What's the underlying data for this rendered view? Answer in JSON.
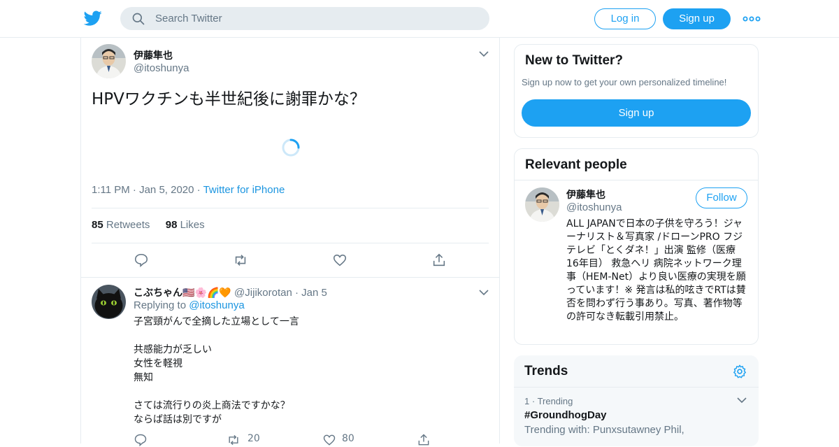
{
  "colors": {
    "accent": "#1da1f2",
    "link": "#1b95e0",
    "muted": "#657786",
    "border": "#e6ecf0",
    "like": "#e0245e"
  },
  "header": {
    "logo_icon": "twitter-bird-icon",
    "search_placeholder": "Search Twitter",
    "login_label": "Log in",
    "signup_label": "Sign up",
    "more_icon": "more-dots-icon"
  },
  "tweet": {
    "name": "伊藤隼也",
    "handle": "@itoshunya",
    "text": "HPVワクチンも半世紀後に謝罪かな？",
    "time": "1:11 PM",
    "date": "Jan 5, 2020",
    "source": "Twitter for iPhone",
    "retweets_count": "85",
    "retweets_label": "Retweets",
    "likes_count": "98",
    "likes_label": "Likes"
  },
  "reply": {
    "name": "こぶちゃん🇺🇸🌸🌈🧡",
    "handle": "@Jijikorotan",
    "date": "Jan 5",
    "replying_prefix": "Replying to",
    "replying_to": "@itoshunya",
    "lines": [
      "子宮頸がんで全摘した立場として一言",
      "",
      "共感能力が乏しい",
      "女性を軽視",
      "無知",
      "",
      "さては流行りの炎上商法ですかな？",
      "ならば話は別ですが"
    ],
    "retweets": "20",
    "likes": "80"
  },
  "new_to_twitter": {
    "title": "New to Twitter?",
    "subtitle": "Sign up now to get your own personalized timeline!",
    "button": "Sign up"
  },
  "relevant": {
    "title": "Relevant people",
    "name": "伊藤隼也",
    "handle": "@itoshunya",
    "follow_label": "Follow",
    "bio": "ALL JAPANで日本の子供を守ろう！ジャーナリスト＆写真家 /ドローンPRO フジテレビ「とくダネ！」出演 監修（医療 16年目） 救急ヘリ 病院ネットワーク理事（HEM-Net）より良い医療の実現を願っています！※ 発言は私的呟きでRTは賛否を問わず行う事あり。写真、著作物等の許可なき転載引用禁止。"
  },
  "trends": {
    "title": "Trends",
    "rank": "1",
    "rank_label": "Trending",
    "tag": "#GroundhogDay",
    "with": "Trending with: Punxsutawney Phil,"
  }
}
